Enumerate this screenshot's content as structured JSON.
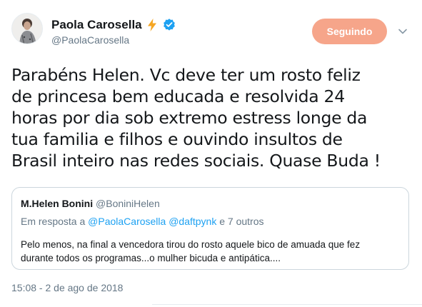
{
  "author": {
    "display_name": "Paola Carosella",
    "handle": "@PaolaCarosella",
    "avatar_icon": "avatar-photo",
    "badges": [
      "lightning-bolt-icon",
      "verified-badge-icon"
    ]
  },
  "follow_button": {
    "label": "Seguindo",
    "color": "#f6a58a"
  },
  "menu": {
    "icon": "chevron-down-icon"
  },
  "tweet": {
    "lines": [
      "Parabéns Helen. Vc deve ter um rosto feliz",
      "de princesa bem educada e resolvida 24",
      "horas por dia sob extremo estress longe da",
      "tua familia e filhos e ouvindo insultos de",
      "Brasil inteiro nas redes sociais. Quase Buda !"
    ],
    "timestamp": "15:08 - 2 de ago de 2018"
  },
  "quoted_tweet": {
    "display_name": "M.Helen Bonini",
    "handle": "@BoniniHelen",
    "reply_prefix": "Em resposta a ",
    "reply_mentions": "@PaolaCarosella @daftpynk",
    "reply_suffix": " e 7 outros",
    "lines": [
      "Pelo menos, na final a vencedora tirou do rosto aquele bico de amuada que fez",
      "durante todos os programas...o mulher bicuda e antipática...."
    ]
  },
  "colors": {
    "link": "#1da1f2",
    "secondary_text": "#657786",
    "border": "#ccd6dd",
    "verified": "#1da1f2",
    "bolt": "#f5a623"
  }
}
